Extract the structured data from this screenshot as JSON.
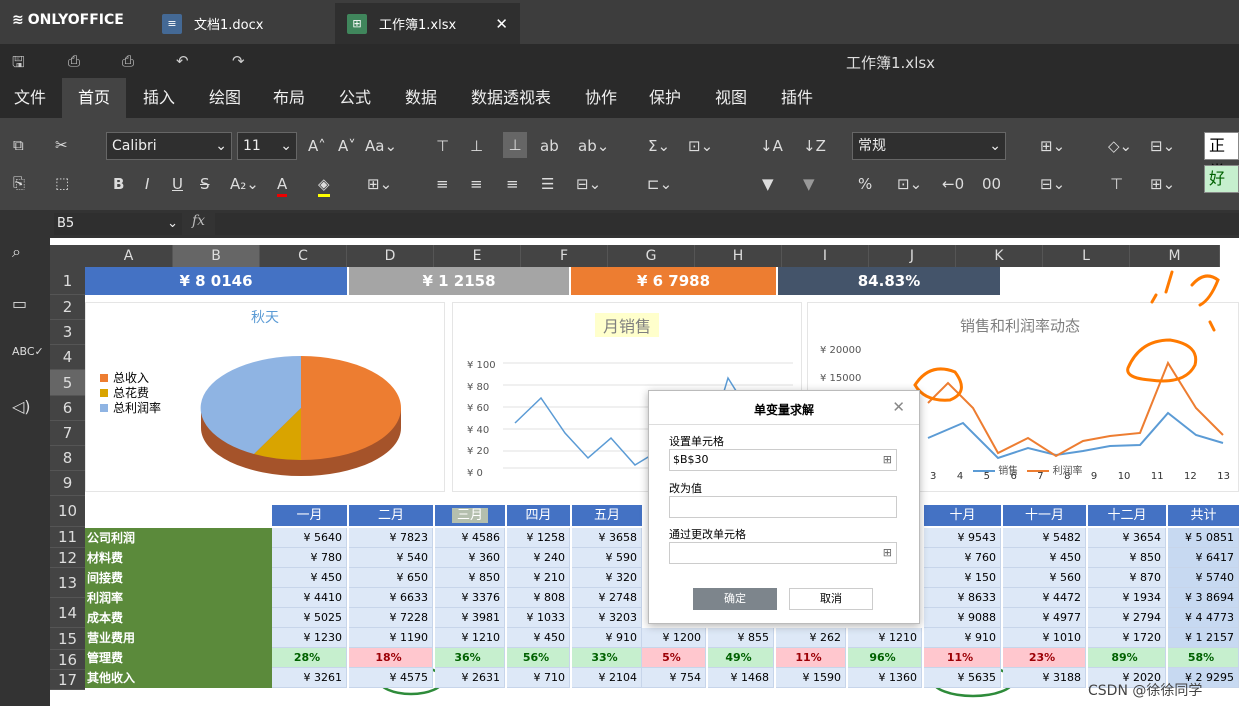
{
  "app": {
    "brand": "ONLYOFFICE",
    "doc_title": "工作簿1.xlsx"
  },
  "tabs": [
    {
      "label": "文档1.docx"
    },
    {
      "label": "工作簿1.xlsx"
    }
  ],
  "menu": [
    "文件",
    "首页",
    "插入",
    "绘图",
    "布局",
    "公式",
    "数据",
    "数据透视表",
    "协作",
    "保护",
    "视图",
    "插件"
  ],
  "toolbar": {
    "font": "Calibri",
    "size": "11",
    "format": "常规",
    "style1": "正常",
    "style2": "好"
  },
  "formula": {
    "cell": "B5",
    "fx": "fx"
  },
  "columns": [
    "A",
    "B",
    "C",
    "D",
    "E",
    "F",
    "G",
    "H",
    "I",
    "J",
    "K",
    "L",
    "M"
  ],
  "rows": [
    "1",
    "2",
    "3",
    "4",
    "5",
    "6",
    "7",
    "8",
    "9",
    "10",
    "11",
    "12",
    "13",
    "14",
    "15",
    "16",
    "17"
  ],
  "kpis": [
    "¥ 8 0146",
    "¥ 1 2158",
    "¥ 6 7988",
    "84.83%"
  ],
  "pie": {
    "title": "秋天",
    "legend": [
      "总收入",
      "总花费",
      "总利润率"
    ]
  },
  "line": {
    "title": "月销售",
    "yticks": [
      "¥ 100",
      "¥ 80",
      "¥ 60",
      "¥ 40",
      "¥ 20",
      "¥ 0"
    ]
  },
  "combo": {
    "title": "销售和利润率动态",
    "yticks": [
      "¥ 20000",
      "¥ 15000"
    ],
    "xticks": [
      "3",
      "4",
      "5",
      "6",
      "7",
      "8",
      "9",
      "10",
      "11",
      "12",
      "13"
    ],
    "legend": [
      "销售",
      "利润率"
    ]
  },
  "months": [
    "一月",
    "二月",
    "三月",
    "四月",
    "五月",
    "十月",
    "十一月",
    "十二月",
    "共计"
  ],
  "row_labels": [
    "公司利润",
    "材料费",
    "间接费",
    "利润率",
    "成本费",
    "营业费用",
    "管理费",
    "其他收入"
  ],
  "table": [
    [
      "¥ 5640",
      "¥ 7823",
      "¥ 4586",
      "¥ 1258",
      "¥ 3658",
      "¥ 9543",
      "¥ 5482",
      "¥ 3654",
      "¥ 5 0851"
    ],
    [
      "¥ 780",
      "¥ 540",
      "¥ 360",
      "¥ 240",
      "¥ 590",
      "¥ 760",
      "¥ 450",
      "¥ 850",
      "¥ 6417"
    ],
    [
      "¥ 450",
      "¥ 650",
      "¥ 850",
      "¥ 210",
      "¥ 320",
      "¥ 150",
      "¥ 560",
      "¥ 870",
      "¥ 5740"
    ],
    [
      "¥ 4410",
      "¥ 6633",
      "¥ 3376",
      "¥ 808",
      "¥ 2748",
      "¥ 8633",
      "¥ 4472",
      "¥ 1934",
      "¥ 3 8694"
    ],
    [
      "¥ 5025",
      "¥ 7228",
      "¥ 3981",
      "¥ 1033",
      "¥ 3203",
      "¥ 9088",
      "¥ 4977",
      "¥ 2794",
      "¥ 4 4773"
    ],
    [
      "¥ 1230",
      "¥ 1190",
      "¥ 1210",
      "¥ 450",
      "¥ 910",
      "¥ 910",
      "¥ 1010",
      "¥ 1720",
      "¥ 1 2157"
    ],
    [
      "28%",
      "18%",
      "36%",
      "56%",
      "33%",
      "11%",
      "23%",
      "89%",
      "58%"
    ],
    [
      "¥ 3261",
      "¥ 4575",
      "¥ 2631",
      "¥ 710",
      "¥ 2104",
      "¥ 5635",
      "¥ 3188",
      "¥ 2020",
      "¥ 2 9295"
    ]
  ],
  "extra_row15": [
    "¥ 1200",
    "¥ 855",
    "¥ 262",
    "¥ 1210"
  ],
  "extra_row16": [
    "5%",
    "49%",
    "11%",
    "96%"
  ],
  "extra_row17": [
    "¥ 754",
    "¥ 1468",
    "¥ 1590",
    "¥ 1360"
  ],
  "dialog": {
    "title": "单变量求解",
    "set_cell_label": "设置单元格",
    "set_cell_value": "$B$30",
    "to_value_label": "改为值",
    "to_value": "",
    "by_change_label": "通过更改单元格",
    "by_change_value": "",
    "ok": "确定",
    "cancel": "取消"
  },
  "watermark": "CSDN @徐徐同学"
}
